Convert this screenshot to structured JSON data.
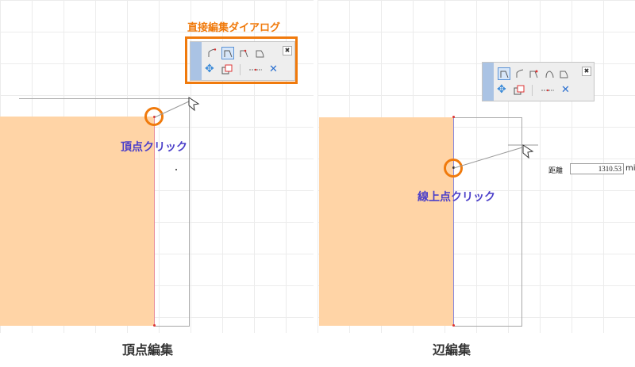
{
  "left": {
    "dialog_title": "直接編集ダイアログ",
    "click_label": "頂点クリック",
    "caption": "頂点編集"
  },
  "right": {
    "click_label": "線上点クリック",
    "caption": "辺編集",
    "distance_label": "距離",
    "distance_value": "1310.53",
    "distance_unit": "mi"
  },
  "dialog": {
    "close_icon": "✖",
    "cancel_icon": "✕",
    "move_icon": "✥"
  },
  "colors": {
    "shape_fill": "#ffd4a6",
    "highlight": "#f07a0c",
    "label_text": "#4b3fc9"
  }
}
